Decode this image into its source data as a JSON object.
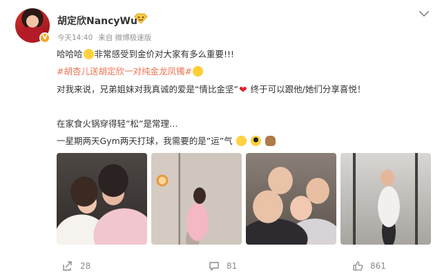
{
  "post": {
    "author": "胡定欣NancyWu",
    "timestamp": "今天14:40",
    "source_prefix": "来自",
    "source": "微博极速版",
    "lines": [
      "哈哈哈",
      "非常感受到金价对大家有多么重要!!!",
      "#胡杏儿送胡定欣一对纯金龙凤镯#",
      "对我来说，兄弟姐妹对我真诚的爱是“情比金坚”",
      "终于可以跟他/她们分享喜悦！",
      "在家食火锅穿得轻”松”是常理…",
      "一星期两天Gym两天打球，我需要的是”运”气"
    ],
    "photos": [
      "photo-1",
      "photo-2",
      "photo-3",
      "photo-4"
    ]
  },
  "footer": {
    "reposts": "28",
    "comments": "81",
    "likes": "861"
  },
  "icons": {
    "vip": "V",
    "heart": "❤"
  },
  "colors": {
    "hashtag": "#eb7350",
    "meta": "#939393",
    "text": "#333333",
    "vip": "#f5a623"
  }
}
